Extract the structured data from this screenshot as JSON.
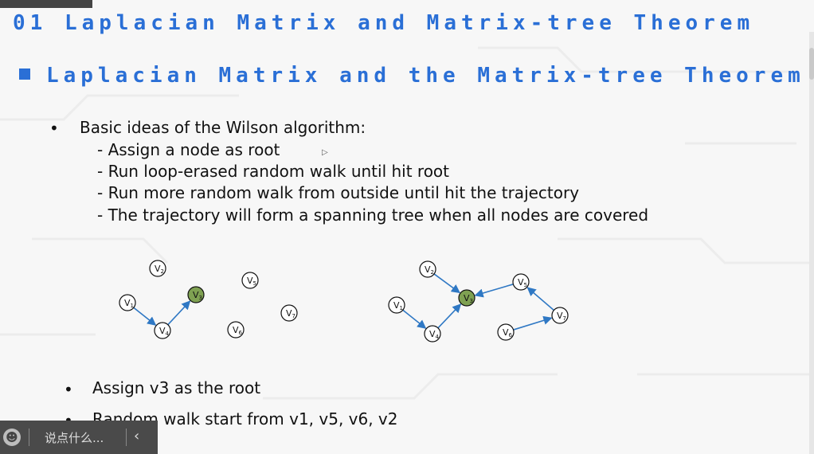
{
  "slide": {
    "page_title": "01 Laplacian Matrix and Matrix-tree Theorem",
    "section_title": "Laplacian Matrix and the Matrix-tree Theorem",
    "main_bullet": "Basic ideas of the Wilson algorithm:",
    "sub_points": [
      "- Assign a node as root",
      "- Run loop-erased random walk until hit root",
      "- Run more random walk from outside until hit the trajectory",
      "- The trajectory will form a spanning tree when all nodes are covered"
    ],
    "bottom_bullets": [
      "Assign v3 as the root",
      "Random walk start from v1, v5, v6, v2"
    ],
    "bullet_char": "•"
  },
  "diagram": {
    "node_label_prefix": "V",
    "root_color": "#7fa152",
    "edge_color": "#2f78c4",
    "left_graph": {
      "nodes": [
        "1",
        "2",
        "3",
        "4",
        "5",
        "6",
        "7"
      ],
      "root": "3",
      "edges": [
        [
          "1",
          "4"
        ],
        [
          "4",
          "3"
        ]
      ]
    },
    "right_graph": {
      "nodes": [
        "1",
        "2",
        "3",
        "4",
        "5",
        "6",
        "7"
      ],
      "root": "3",
      "edges": [
        [
          "1",
          "4"
        ],
        [
          "4",
          "3"
        ],
        [
          "2",
          "3"
        ],
        [
          "5",
          "3"
        ],
        [
          "7",
          "5"
        ],
        [
          "6",
          "7"
        ]
      ]
    }
  },
  "chat": {
    "placeholder": "说点什么...",
    "emoji_icon": "smiley-icon",
    "collapse_icon": "chevron-left-icon",
    "collapse_glyph": "‹",
    "emoji_glyph": "☻"
  }
}
